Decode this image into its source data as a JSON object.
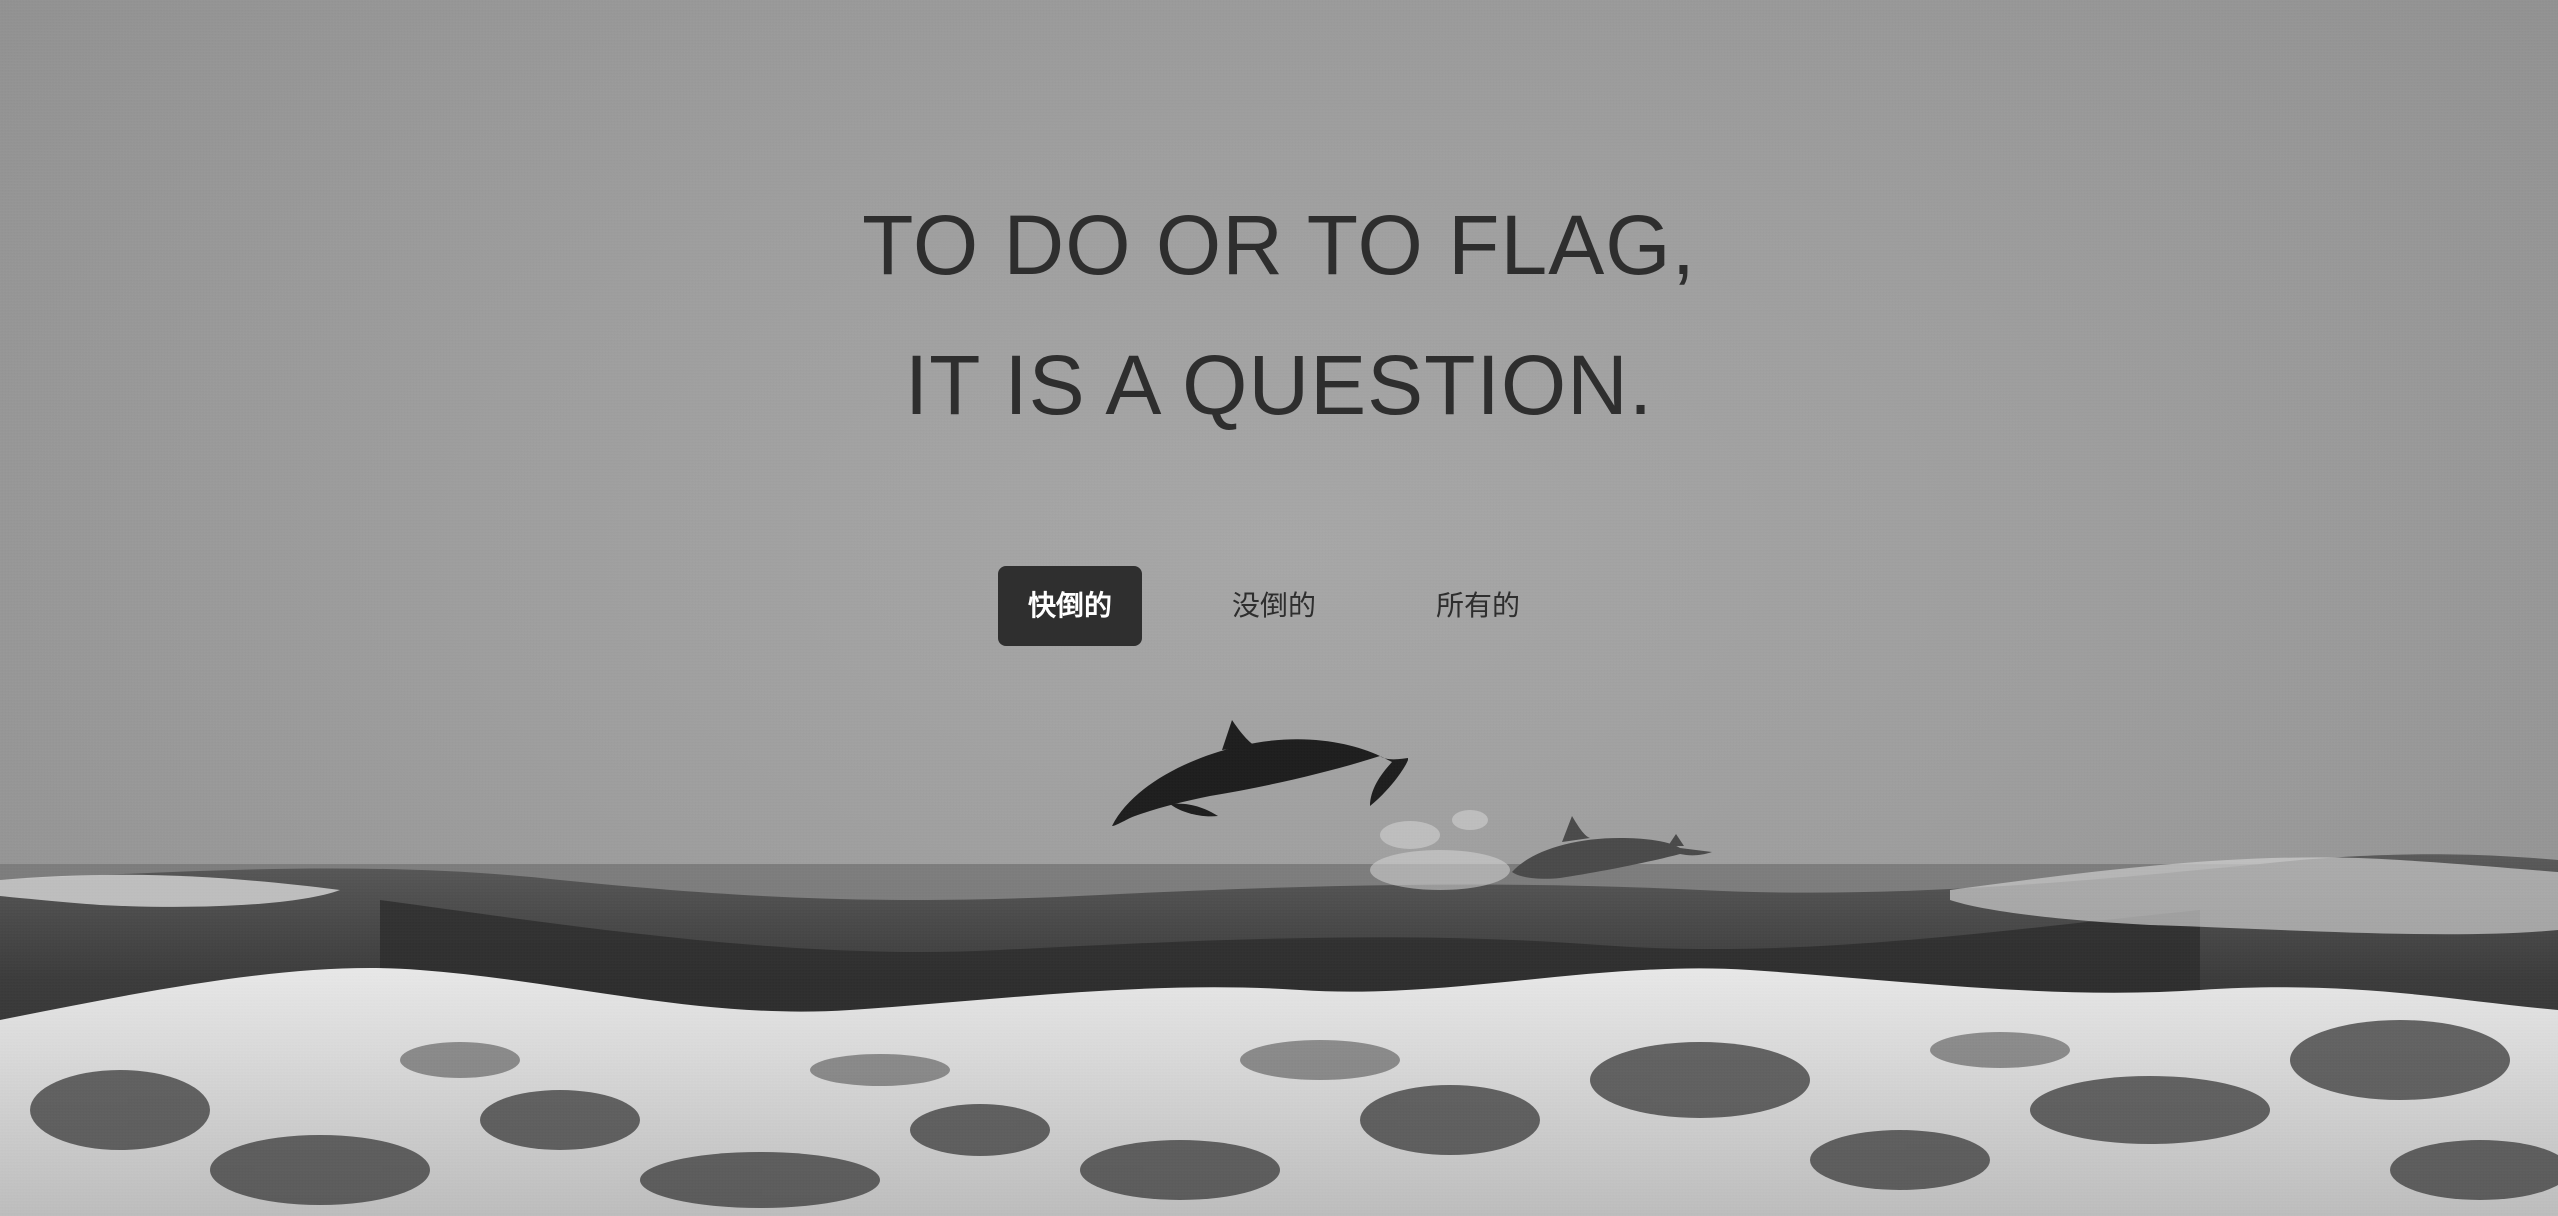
{
  "headline": {
    "line1": "TO DO OR TO FLAG,",
    "line2": "IT IS A QUESTION."
  },
  "filter_tabs": [
    {
      "label": "快倒的",
      "active": true
    },
    {
      "label": "没倒的",
      "active": false
    },
    {
      "label": "所有的",
      "active": false
    }
  ],
  "colors": {
    "text": "#2e2e2e",
    "active_tab_bg": "#2f2f2f",
    "active_tab_text": "#ffffff",
    "sky": "#9e9e9e"
  },
  "background": {
    "subject": "dolphin-icon"
  }
}
